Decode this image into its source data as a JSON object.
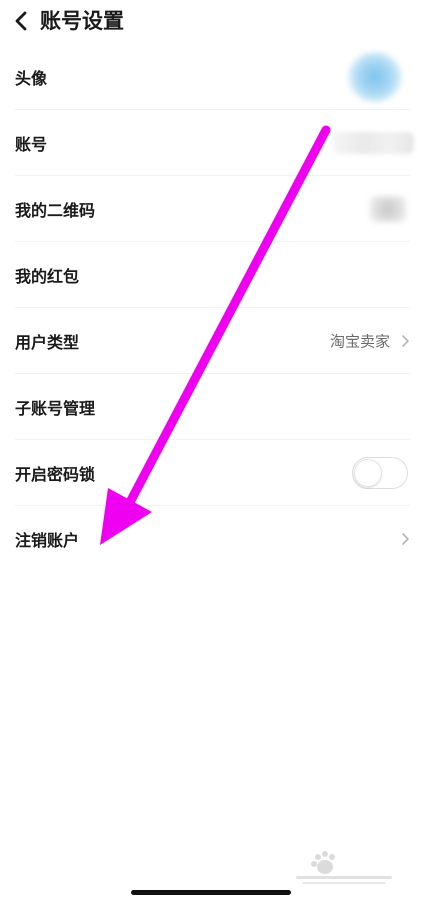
{
  "header": {
    "title": "账号设置",
    "back_icon": "chevron-left-icon"
  },
  "rows": [
    {
      "label": "头像",
      "accessory": "avatar"
    },
    {
      "label": "账号",
      "accessory": "blurred-text"
    },
    {
      "label": "我的二维码",
      "accessory": "qr-code"
    },
    {
      "label": "我的红包",
      "accessory": "none"
    },
    {
      "label": "用户类型",
      "value": "淘宝卖家",
      "accessory": "chevron-right-icon"
    },
    {
      "label": "子账号管理",
      "accessory": "none"
    },
    {
      "label": "开启密码锁",
      "accessory": "toggle",
      "toggle_on": false
    },
    {
      "label": "注销账户",
      "accessory": "chevron-right-icon"
    }
  ],
  "annotation": {
    "type": "arrow",
    "color": "#f000f0",
    "points_to": "注销账户"
  },
  "colors": {
    "background": "#ffffff",
    "text_primary": "#1a1a1a",
    "text_secondary": "#6b6b6b",
    "divider": "#f2f2f2",
    "arrow": "#f000f0"
  }
}
